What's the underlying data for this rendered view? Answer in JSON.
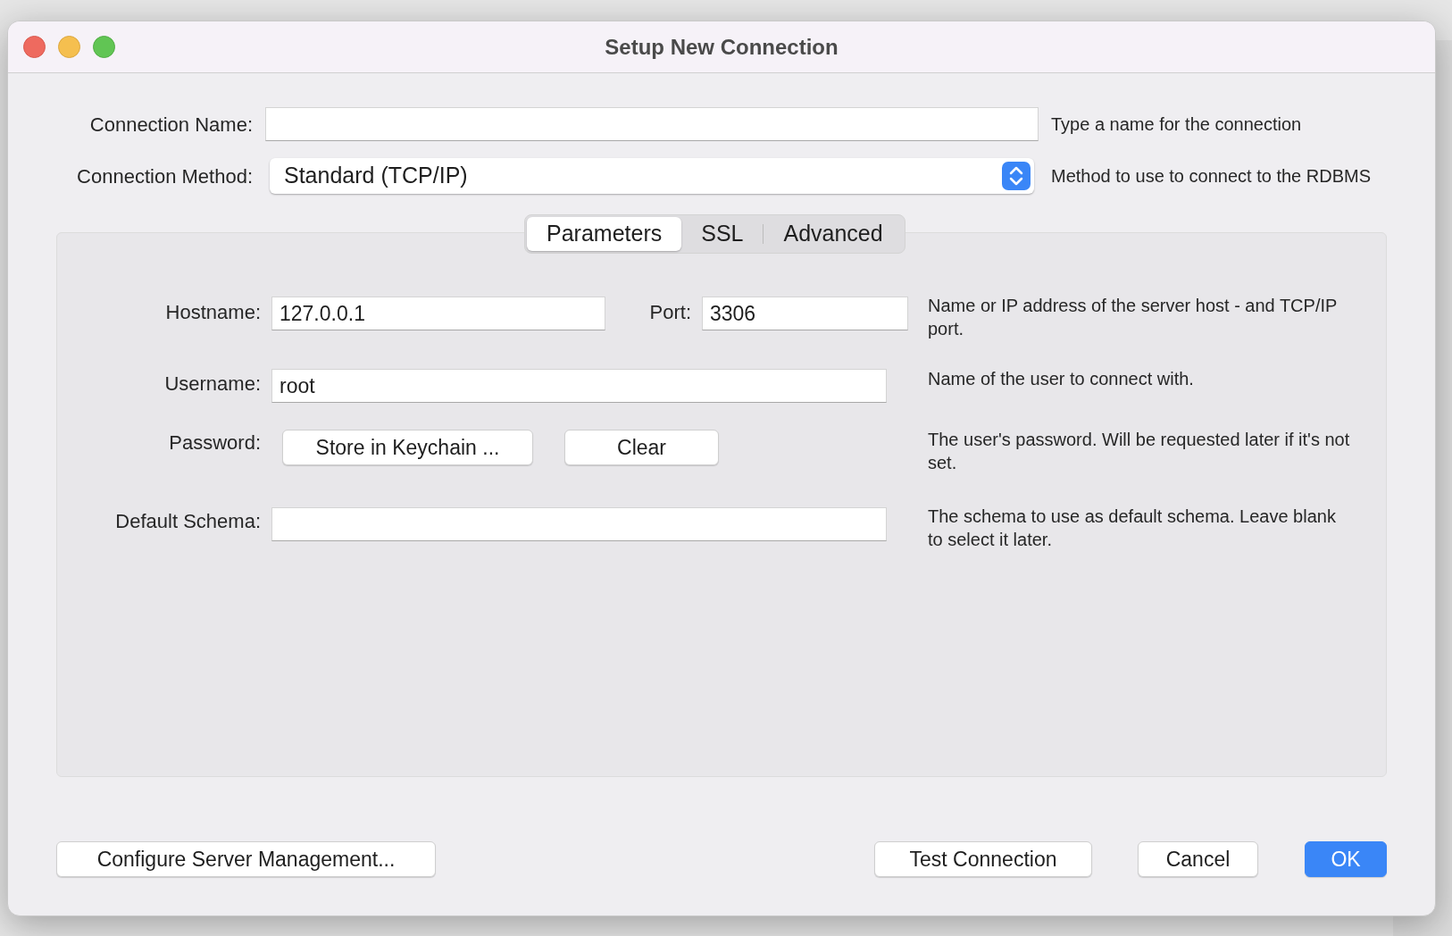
{
  "window": {
    "title": "Setup New Connection"
  },
  "connection_name": {
    "label": "Connection Name:",
    "hint": "Type a name for the connection"
  },
  "connection_method": {
    "label": "Connection Method:",
    "value": "Standard (TCP/IP)",
    "hint": "Method to use to connect to the RDBMS"
  },
  "tabs": [
    {
      "label": "Parameters",
      "selected": true
    },
    {
      "label": "SSL",
      "selected": false
    },
    {
      "label": "Advanced",
      "selected": false
    }
  ],
  "parameters": {
    "hostname": {
      "label": "Hostname:",
      "value": "127.0.0.1"
    },
    "port": {
      "label": "Port:",
      "value": "3306"
    },
    "host_hint": "Name or IP address of the server host - and TCP/IP port.",
    "username": {
      "label": "Username:",
      "value": "root",
      "hint": "Name of the user to connect with."
    },
    "password": {
      "label": "Password:",
      "buttons": [
        "Store in Keychain ...",
        "Clear"
      ],
      "hint": "The user's password. Will be requested later if it's not set."
    },
    "default_schema": {
      "label": "Default Schema:",
      "hint": "The schema to use as default schema. Leave blank to select it later."
    }
  },
  "footer": {
    "left_button": "Configure Server Management...",
    "buttons": [
      {
        "label": "Test Connection",
        "primary": false
      },
      {
        "label": "Cancel",
        "primary": false
      },
      {
        "label": "OK",
        "primary": true
      }
    ]
  }
}
